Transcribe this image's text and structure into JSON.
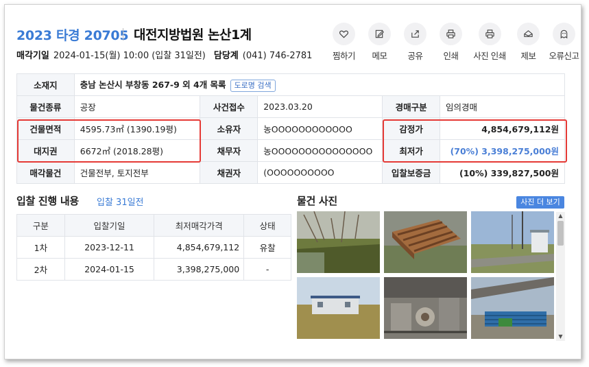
{
  "header": {
    "case_number": "2023 타경 20705",
    "court_name": "대전지방법원 논산1계",
    "sale_date_label": "매각기일",
    "sale_date_value": "2024-01-15(월) 10:00 (입찰 31일전)",
    "manager_label": "담당계",
    "manager_phone": "(041) 746-2781"
  },
  "actions": [
    {
      "label": "찜하기",
      "icon": "heart-icon"
    },
    {
      "label": "메모",
      "icon": "edit-icon"
    },
    {
      "label": "공유",
      "icon": "share-icon"
    },
    {
      "label": "인쇄",
      "icon": "print-icon"
    },
    {
      "label": "사진 인쇄",
      "icon": "print-icon"
    },
    {
      "label": "제보",
      "icon": "megaphone-icon"
    },
    {
      "label": "오류신고",
      "icon": "ghost-icon"
    }
  ],
  "info": {
    "location_label": "소재지",
    "location_value": "충남 논산시 부창동 267-9 외 4개 목록",
    "road_search_label": "도로명 검색",
    "type_label": "물건종류",
    "type_value": "공장",
    "received_label": "사건접수",
    "received_value": "2023.03.20",
    "auction_type_label": "경매구분",
    "auction_type_value": "임의경매",
    "building_area_label": "건물면적",
    "building_area_value": "4595.73㎡ (1390.19평)",
    "owner_label": "소유자",
    "owner_value": "농OOOOOOOOOOOO",
    "appraisal_label": "감정가",
    "appraisal_value": "4,854,679,112원",
    "land_right_label": "대지권",
    "land_right_value": "6672㎡ (2018.28평)",
    "debtor_label": "채무자",
    "debtor_value": "농OOOOOOOOOOOOOOO",
    "min_price_label": "최저가",
    "min_price_value": "(70%) 3,398,275,000원",
    "sale_items_label": "매각물건",
    "sale_items_value": "건물전부, 토지전부",
    "creditor_label": "채권자",
    "creditor_value": "(OOOOOOOOOO",
    "deposit_label": "입찰보증금",
    "deposit_value": "(10%) 339,827,500원"
  },
  "bid_section": {
    "title": "입찰 진행 내용",
    "subtitle": "입찰 31일전",
    "columns": [
      "구분",
      "입찰기일",
      "최저매각가격",
      "상태"
    ],
    "rows": [
      [
        "1차",
        "2023-12-11",
        "4,854,679,112",
        "유찰"
      ],
      [
        "2차",
        "2024-01-15",
        "3,398,275,000",
        "-"
      ]
    ]
  },
  "photo_section": {
    "title": "물건 사진",
    "more_button": "사진 더 보기",
    "photos": [
      "photo-orchard-field",
      "photo-wooden-pallet",
      "photo-guardhouse-road",
      "photo-container-building",
      "photo-factory-machinery",
      "photo-warehouse-shed"
    ]
  },
  "colors": {
    "accent": "#3a7bd5",
    "highlight_box": "#e53935",
    "header_cell": "#f4f6f9"
  }
}
